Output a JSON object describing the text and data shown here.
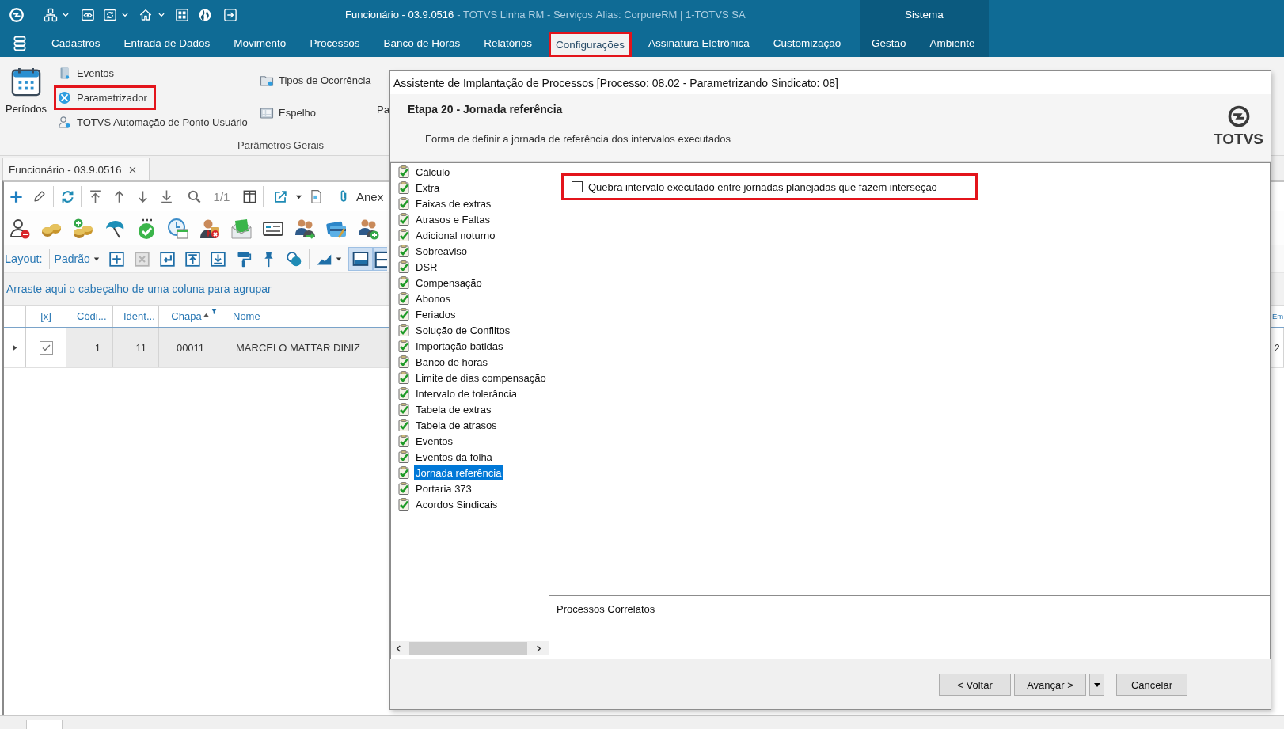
{
  "title_bar": {
    "title": "Funcionário - 03.9.0516",
    "product": "- TOTVS Linha RM - Serviços",
    "alias": "Alias: CorporeRM | 1-TOTVS SA"
  },
  "system_section": {
    "label": "Sistema"
  },
  "menu": [
    {
      "label": "Cadastros",
      "kind": "app",
      "selected": false,
      "highlighted": false
    },
    {
      "label": "Entrada de Dados",
      "kind": "app",
      "selected": false,
      "highlighted": false
    },
    {
      "label": "Movimento",
      "kind": "app",
      "selected": false,
      "highlighted": false
    },
    {
      "label": "Processos",
      "kind": "app",
      "selected": false,
      "highlighted": false
    },
    {
      "label": "Banco de Horas",
      "kind": "app",
      "selected": false,
      "highlighted": false
    },
    {
      "label": "Relatórios",
      "kind": "app",
      "selected": false,
      "highlighted": false
    },
    {
      "label": "Configurações",
      "kind": "app",
      "selected": true,
      "highlighted": true
    },
    {
      "label": "Assinatura Eletrônica",
      "kind": "app",
      "selected": false,
      "highlighted": false
    },
    {
      "label": "Customização",
      "kind": "app",
      "selected": false,
      "highlighted": false
    },
    {
      "label": "Gestão",
      "kind": "system",
      "selected": false,
      "highlighted": false
    },
    {
      "label": "Ambiente",
      "kind": "system",
      "selected": false,
      "highlighted": false
    }
  ],
  "ribbon": {
    "large_button": "Períodos",
    "items": [
      {
        "label": "Eventos",
        "highlighted": false
      },
      {
        "label": "Parametrizador",
        "highlighted": true
      },
      {
        "label": "TOTVS Automação de Ponto Usuário",
        "highlighted": false
      }
    ],
    "items_2": [
      {
        "label": "Tipos de Ocorrência"
      },
      {
        "label": "Espelho"
      }
    ],
    "items_3": [
      {
        "label": "Pa"
      }
    ],
    "group_label": "Parâmetros Gerais"
  },
  "document_tab": {
    "label": "Funcionário - 03.9.0516"
  },
  "toolbar": {
    "page_count": "1/1",
    "attachments": "Anex"
  },
  "layout_bar": {
    "label": "Layout:",
    "value": "Padrão",
    "view_toggles": [
      {
        "selected": true
      },
      {
        "selected": true
      }
    ]
  },
  "group_hint": "Arraste aqui o cabeçalho de uma coluna para agrupar",
  "grid": {
    "columns": [
      {
        "label": "[x]",
        "sorted": false,
        "filtered": false
      },
      {
        "label": "Códi...",
        "sorted": false,
        "filtered": false
      },
      {
        "label": "Ident...",
        "sorted": false,
        "filtered": false
      },
      {
        "label": "Chapa",
        "sorted": true,
        "filtered": true
      },
      {
        "label": "Nome",
        "sorted": false,
        "filtered": false
      },
      {
        "label": "Em",
        "sorted": false,
        "filtered": false
      }
    ],
    "rows": [
      {
        "expanded": false,
        "checked": true,
        "cells": [
          "",
          "1",
          "11",
          "00011",
          "MARCELO MATTAR DINIZ",
          "2"
        ]
      }
    ]
  },
  "dialog": {
    "title": "Assistente de Implantação de Processos [Processo: 08.02 - Parametrizando Sindicato: 08]",
    "step_title": "Etapa 20 - Jornada referência",
    "step_description": "Forma de definir a jornada de referência dos intervalos executados",
    "logo": "TOTVS",
    "steps": [
      {
        "label": "Cálculo",
        "selected": false
      },
      {
        "label": "Extra",
        "selected": false
      },
      {
        "label": "Faixas de extras",
        "selected": false
      },
      {
        "label": "Atrasos e Faltas",
        "selected": false
      },
      {
        "label": "Adicional noturno",
        "selected": false
      },
      {
        "label": "Sobreaviso",
        "selected": false
      },
      {
        "label": "DSR",
        "selected": false
      },
      {
        "label": "Compensação",
        "selected": false
      },
      {
        "label": "Abonos",
        "selected": false
      },
      {
        "label": "Feriados",
        "selected": false
      },
      {
        "label": "Solução de Conflitos",
        "selected": false
      },
      {
        "label": "Importação batidas",
        "selected": false
      },
      {
        "label": "Banco de horas",
        "selected": false
      },
      {
        "label": "Limite de dias compensação",
        "selected": false
      },
      {
        "label": "Intervalo de tolerância",
        "selected": false
      },
      {
        "label": "Tabela de extras",
        "selected": false
      },
      {
        "label": "Tabela de atrasos",
        "selected": false
      },
      {
        "label": "Eventos",
        "selected": false
      },
      {
        "label": "Eventos da folha",
        "selected": false
      },
      {
        "label": "Jornada referência",
        "selected": true
      },
      {
        "label": "Portaria 373",
        "selected": false
      },
      {
        "label": "Acordos Sindicais",
        "selected": false
      }
    ],
    "option": {
      "label": "Quebra intervalo executado entre jornadas planejadas que fazem interseção",
      "checked": false,
      "highlighted": true
    },
    "related_title": "Processos Correlatos",
    "buttons": [
      {
        "label": "< Voltar",
        "kind": "button"
      },
      {
        "label": "Avançar >",
        "kind": "split"
      },
      {
        "label": "Cancelar",
        "kind": "button"
      }
    ]
  }
}
